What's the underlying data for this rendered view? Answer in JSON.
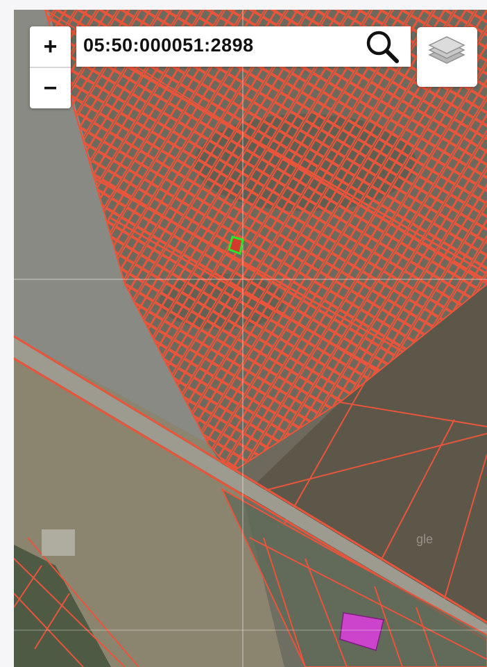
{
  "map": {
    "search_value": "05:50:000051:2898",
    "watermark": "gle",
    "colors": {
      "parcel_outline": "#e8553a",
      "selected_outline": "#29e62c",
      "selected_fill": "#d33a2e",
      "highlight_building": "#cc44cc"
    }
  },
  "controls": {
    "zoom_in_label": "+",
    "zoom_out_label": "−",
    "search_icon": "magnifier-icon",
    "layers_icon": "layers-icon"
  }
}
